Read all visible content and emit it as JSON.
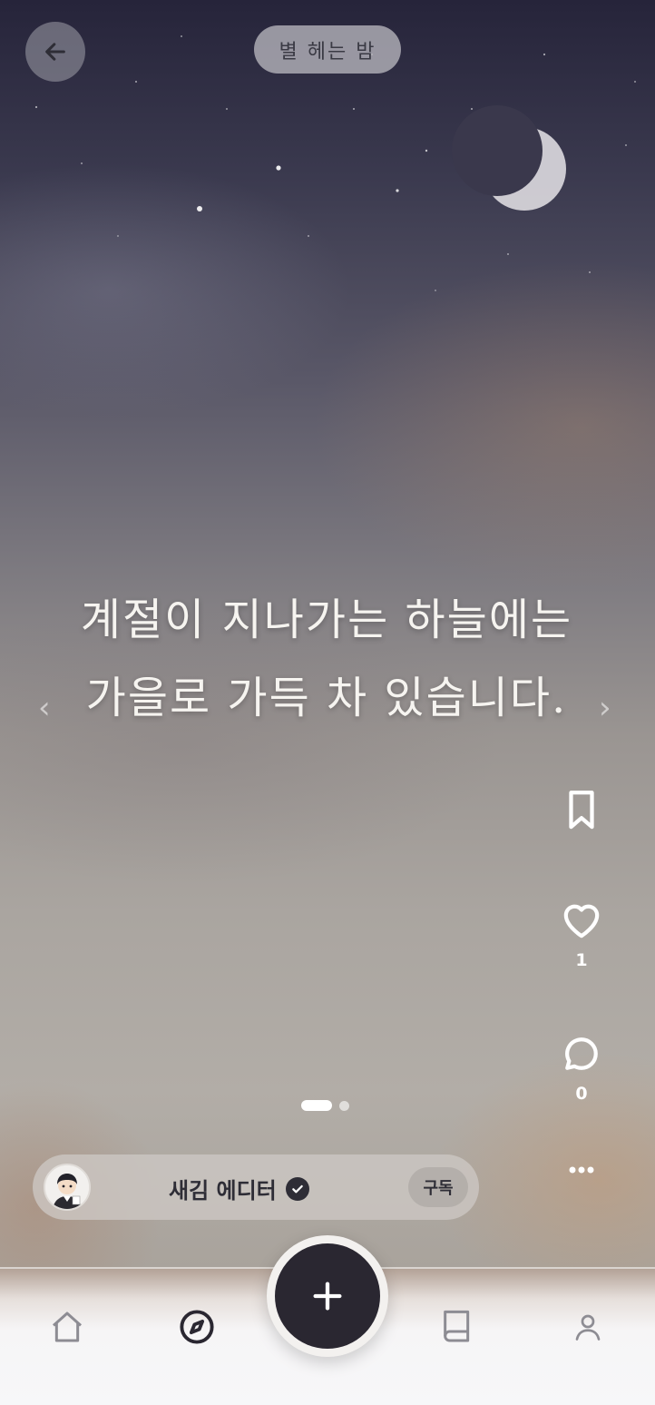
{
  "header": {
    "title": "별 헤는 밤",
    "back_icon": "arrow-left-icon"
  },
  "post": {
    "quote_line_1": "계절이 지나가는 하늘에는",
    "quote_line_2": "가을로 가득 차 있습니다.",
    "prev_glyph": "‹",
    "next_glyph": "›",
    "pager": {
      "total": 2,
      "current": 1
    }
  },
  "actions": {
    "bookmark_icon": "bookmark-icon",
    "like_icon": "heart-icon",
    "like_count": "1",
    "comment_icon": "comment-icon",
    "comment_count": "0",
    "more_icon": "more-dots-icon"
  },
  "author": {
    "name": "새김 에디터",
    "verified_icon": "verified-check-icon",
    "subscribe_label": "구독"
  },
  "tabbar": {
    "items": [
      "home-icon",
      "compass-icon",
      "plus-icon",
      "book-icon",
      "profile-icon"
    ],
    "accent": "#2a2731"
  }
}
